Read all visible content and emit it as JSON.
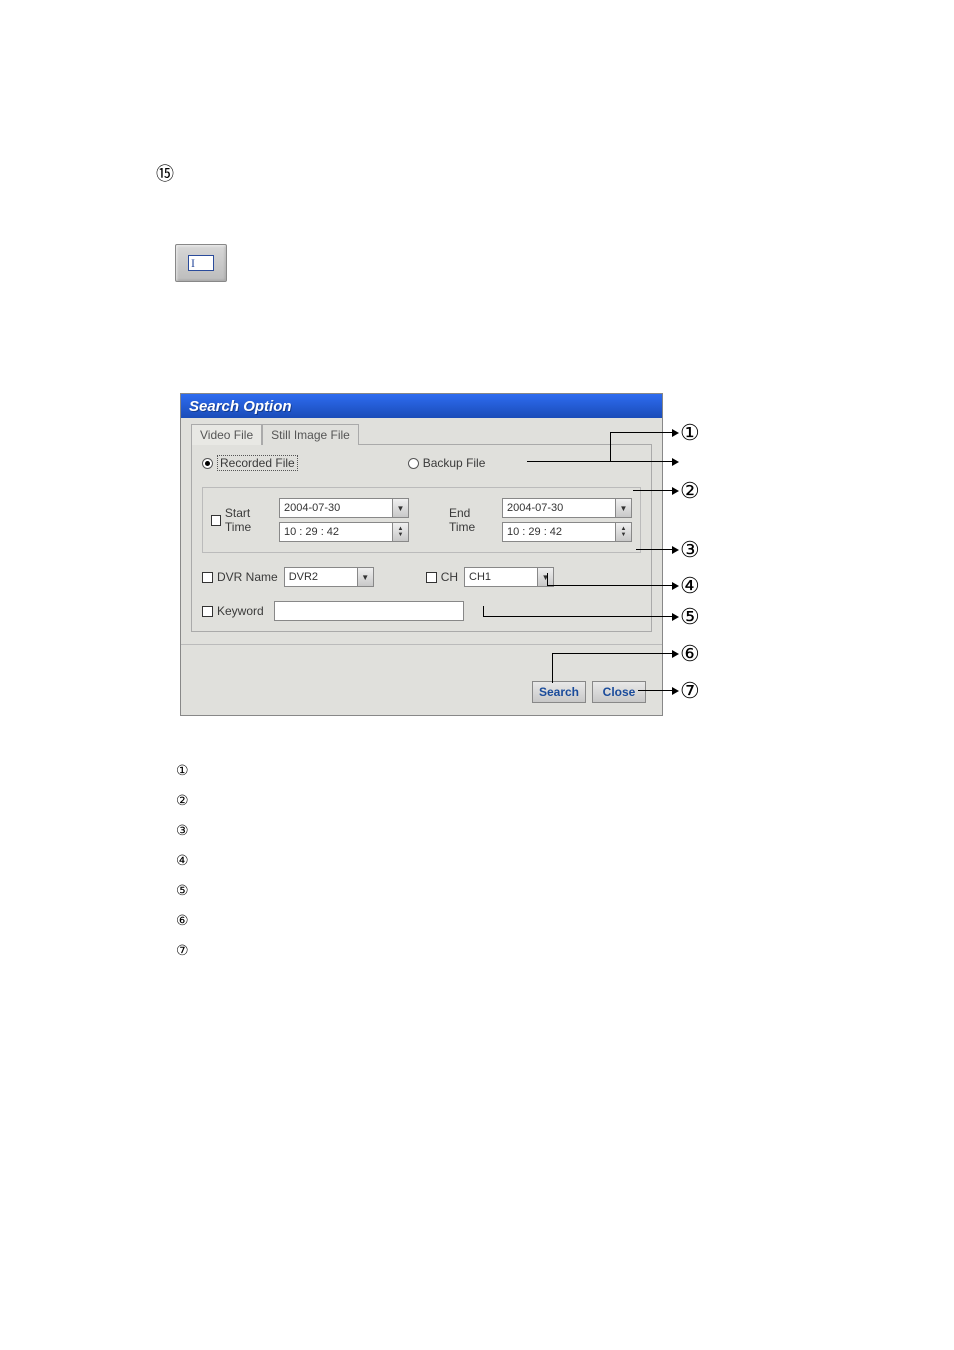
{
  "page_marker": "⑮",
  "dialog": {
    "title": "Search Option",
    "tabs": [
      "Video File",
      "Still Image File"
    ],
    "active_tab": 0,
    "radios": {
      "recorded": "Recorded File",
      "backup": "Backup File",
      "selected": "recorded"
    },
    "start_time_label": "Start Time",
    "end_time_label": "End Time",
    "start_date": "2004-07-30",
    "start_time": "10 : 29 : 42",
    "end_date": "2004-07-30",
    "end_time": "10 : 29 : 42",
    "dvr_name_label": "DVR Name",
    "dvr_name_value": "DVR2",
    "ch_label": "CH",
    "ch_value": "CH1",
    "keyword_label": "Keyword",
    "keyword_value": "",
    "search_btn": "Search",
    "close_btn": "Close"
  },
  "callouts": [
    "①",
    "②",
    "③",
    "④",
    "⑤",
    "⑥",
    "⑦"
  ],
  "list_nums": [
    "①",
    "②",
    "③",
    "④",
    "⑤",
    "⑥",
    "⑦"
  ]
}
